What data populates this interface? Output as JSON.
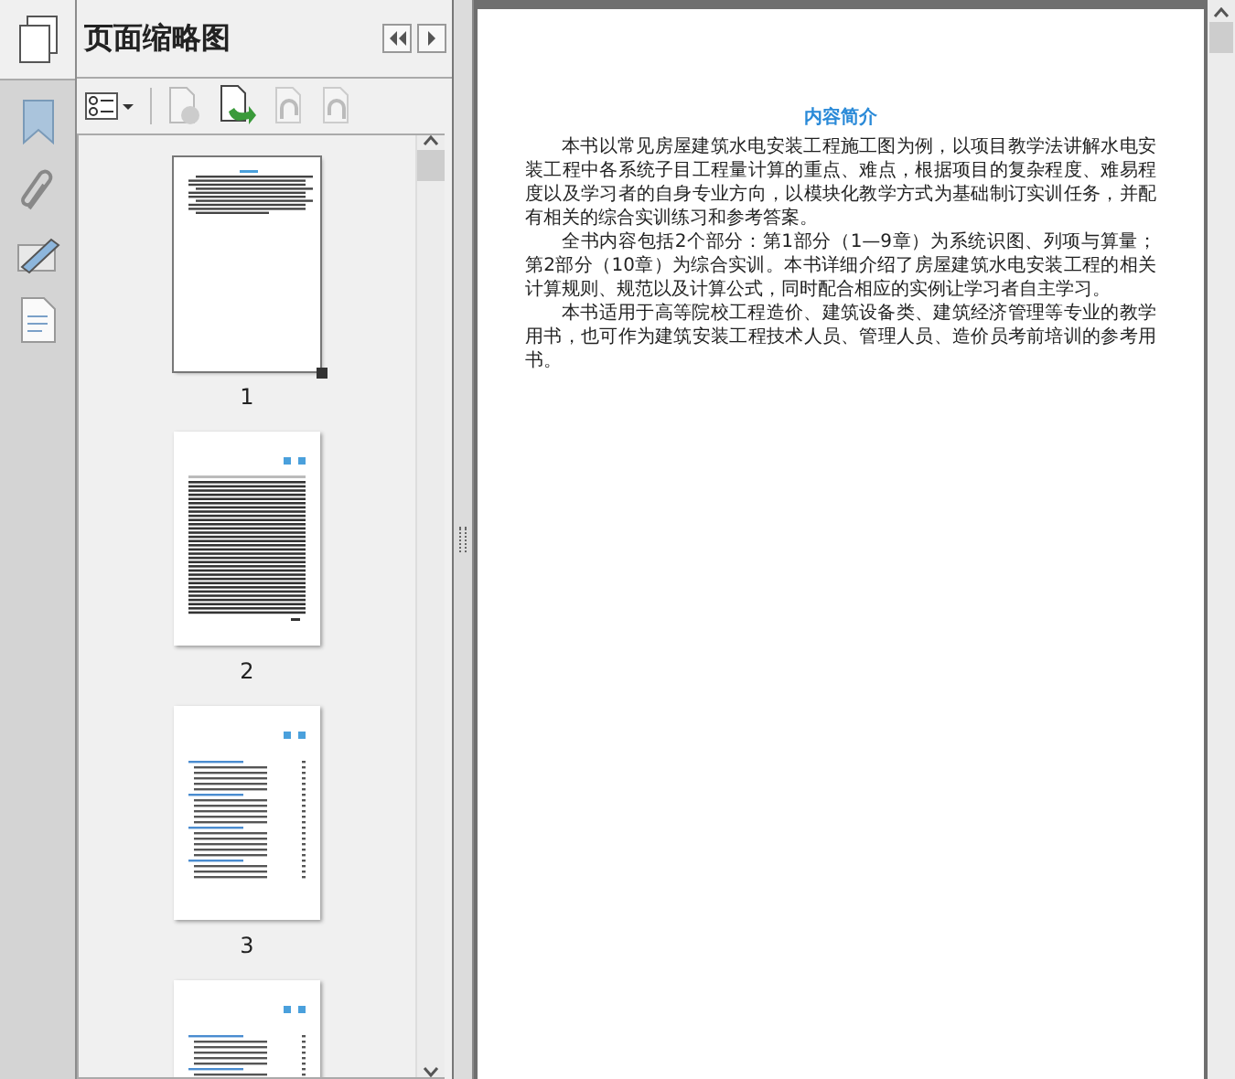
{
  "panel": {
    "title": "页面缩略图"
  },
  "thumbnails": [
    {
      "label": "1",
      "selected": true,
      "kind": "intro"
    },
    {
      "label": "2",
      "selected": false,
      "kind": "preface"
    },
    {
      "label": "3",
      "selected": false,
      "kind": "contents"
    },
    {
      "selected": false,
      "kind": "contents"
    }
  ],
  "document": {
    "heading": "内容简介",
    "paragraphs": [
      "本书以常见房屋建筑水电安装工程施工图为例，以项目教学法讲解水电安装工程中各系统子目工程量计算的重点、难点，根据项目的复杂程度、难易程度以及学习者的自身专业方向，以模块化教学方式为基础制订实训任务，并配有相关的综合实训练习和参考答案。",
      "全书内容包括2个部分：第1部分（1—9章）为系统识图、列项与算量；第2部分（10章）为综合实训。本书详细介绍了房屋建筑水电安装工程的相关计算规则、规范以及计算公式，同时配合相应的实例让学习者自主学习。",
      "本书适用于高等院校工程造价、建筑设备类、建筑经济管理等专业的教学用书，也可作为建筑安装工程技术人员、管理人员、造价员考前培训的参考用书。"
    ]
  }
}
